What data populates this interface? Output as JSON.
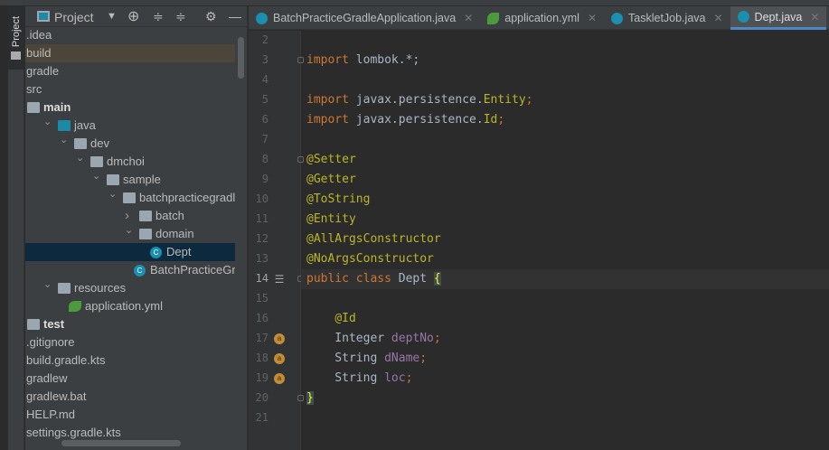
{
  "sidebar_tab": "Project",
  "panel": {
    "title": "Project",
    "icons": [
      "dropdown-icon",
      "locate-icon",
      "expand-all-icon",
      "collapse-all-icon",
      "gear-icon",
      "minimize-icon"
    ]
  },
  "tree": [
    {
      "label": ".idea",
      "depth": 0
    },
    {
      "label": "build",
      "depth": 0,
      "highlight": true
    },
    {
      "label": "gradle",
      "depth": 0
    },
    {
      "label": "src",
      "depth": 0
    },
    {
      "label": "main",
      "depth": 0,
      "icon": "source-folder",
      "bold": true
    },
    {
      "label": "java",
      "depth": 1,
      "arrow": "down",
      "icon": "folder-blue"
    },
    {
      "label": "dev",
      "depth": 2,
      "arrow": "down",
      "icon": "package"
    },
    {
      "label": "dmchoi",
      "depth": 3,
      "arrow": "down",
      "icon": "package"
    },
    {
      "label": "sample",
      "depth": 4,
      "arrow": "down",
      "icon": "package"
    },
    {
      "label": "batchpracticegradle",
      "depth": 5,
      "arrow": "down",
      "icon": "package"
    },
    {
      "label": "batch",
      "depth": 6,
      "arrow": "right",
      "icon": "package"
    },
    {
      "label": "domain",
      "depth": 6,
      "arrow": "down",
      "icon": "package"
    },
    {
      "label": "Dept",
      "depth": 7,
      "icon": "class",
      "selected": true
    },
    {
      "label": "BatchPracticeGradleApplication",
      "depth": 6.1,
      "icon": "spring-class"
    },
    {
      "label": "resources",
      "depth": 1,
      "arrow": "down",
      "icon": "resources"
    },
    {
      "label": "application.yml",
      "depth": 2.1,
      "icon": "spring-yml"
    },
    {
      "label": "test",
      "depth": 0,
      "icon": "folder",
      "bold": true
    },
    {
      "label": ".gitignore",
      "depth": 0
    },
    {
      "label": "build.gradle.kts",
      "depth": 0
    },
    {
      "label": "gradlew",
      "depth": 0
    },
    {
      "label": "gradlew.bat",
      "depth": 0
    },
    {
      "label": "HELP.md",
      "depth": 0
    },
    {
      "label": "settings.gradle.kts",
      "depth": 0
    }
  ],
  "tabs": [
    {
      "label": "BatchPracticeGradleApplication.java",
      "icon": "spring-class"
    },
    {
      "label": "application.yml",
      "icon": "spring-yml"
    },
    {
      "label": "TaskletJob.java",
      "icon": "class"
    },
    {
      "label": "Dept.java",
      "icon": "class",
      "active": true
    }
  ],
  "code": [
    {
      "n": "2",
      "parts": []
    },
    {
      "n": "3",
      "parts": [
        [
          "kw",
          "import "
        ],
        [
          "",
          "lombok.*;"
        ]
      ]
    },
    {
      "n": "4",
      "parts": []
    },
    {
      "n": "5",
      "parts": [
        [
          "kw",
          "import "
        ],
        [
          "",
          "javax.persistence."
        ],
        [
          "an",
          "Entity"
        ],
        [
          "kw",
          ";"
        ]
      ]
    },
    {
      "n": "6",
      "parts": [
        [
          "kw",
          "import "
        ],
        [
          "",
          "javax.persistence."
        ],
        [
          "an",
          "Id"
        ],
        [
          "kw",
          ";"
        ]
      ]
    },
    {
      "n": "7",
      "parts": []
    },
    {
      "n": "8",
      "parts": [
        [
          "an",
          "@Setter"
        ]
      ]
    },
    {
      "n": "9",
      "parts": [
        [
          "an",
          "@Getter"
        ]
      ]
    },
    {
      "n": "10",
      "parts": [
        [
          "an",
          "@ToString"
        ]
      ]
    },
    {
      "n": "11",
      "parts": [
        [
          "an",
          "@Entity"
        ]
      ]
    },
    {
      "n": "12",
      "parts": [
        [
          "an",
          "@AllArgsConstructor"
        ]
      ]
    },
    {
      "n": "13",
      "parts": [
        [
          "an",
          "@NoArgsConstructor"
        ]
      ]
    },
    {
      "n": "14",
      "parts": [
        [
          "kw",
          "public class "
        ],
        [
          "",
          "Dept "
        ],
        [
          "br",
          "{"
        ]
      ],
      "current": true,
      "gutter_icon": "entity-icon"
    },
    {
      "n": "15",
      "parts": []
    },
    {
      "n": "16",
      "parts": [
        [
          "",
          "    "
        ],
        [
          "an",
          "@Id"
        ]
      ]
    },
    {
      "n": "17",
      "parts": [
        [
          "",
          "    Integer "
        ],
        [
          "fld",
          "deptNo"
        ],
        [
          "kw",
          ";"
        ]
      ],
      "gutter_icon": "field-id-icon"
    },
    {
      "n": "18",
      "parts": [
        [
          "",
          "    String "
        ],
        [
          "fld",
          "dName"
        ],
        [
          "kw",
          ";"
        ]
      ],
      "gutter_icon": "field-icon"
    },
    {
      "n": "19",
      "parts": [
        [
          "",
          "    String "
        ],
        [
          "fld",
          "loc"
        ],
        [
          "kw",
          ";"
        ]
      ],
      "gutter_icon": "field-icon"
    },
    {
      "n": "20",
      "parts": [
        [
          "br",
          "}"
        ]
      ]
    },
    {
      "n": "21",
      "parts": []
    }
  ]
}
